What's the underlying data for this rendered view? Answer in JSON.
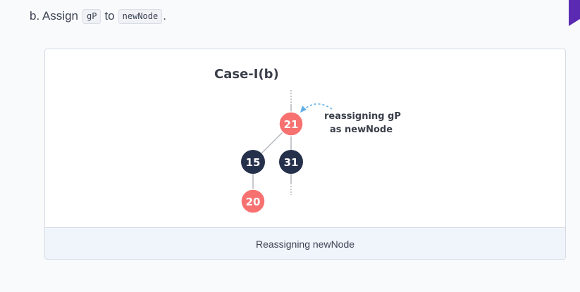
{
  "step": {
    "prefix": "b. Assign",
    "code_1": "gP",
    "middle": "to",
    "code_2": "newNode",
    "suffix": "."
  },
  "figure": {
    "diagram_title": "Case-I(b)",
    "annotation_line_1": "reassigning gP",
    "annotation_line_2": "as newNode",
    "nodes": {
      "n21": {
        "label": "21",
        "color": "#f77171"
      },
      "n15": {
        "label": "15",
        "color": "#25304b"
      },
      "n31": {
        "label": "31",
        "color": "#25304b"
      },
      "n20": {
        "label": "20",
        "color": "#f77171"
      }
    },
    "caption": "Reassigning newNode"
  },
  "colors": {
    "red_node": "#f77171",
    "black_node": "#25304b",
    "arrow": "#61aee6",
    "edge": "#b4b7bd",
    "corner_accent": "#5b2ab3"
  }
}
